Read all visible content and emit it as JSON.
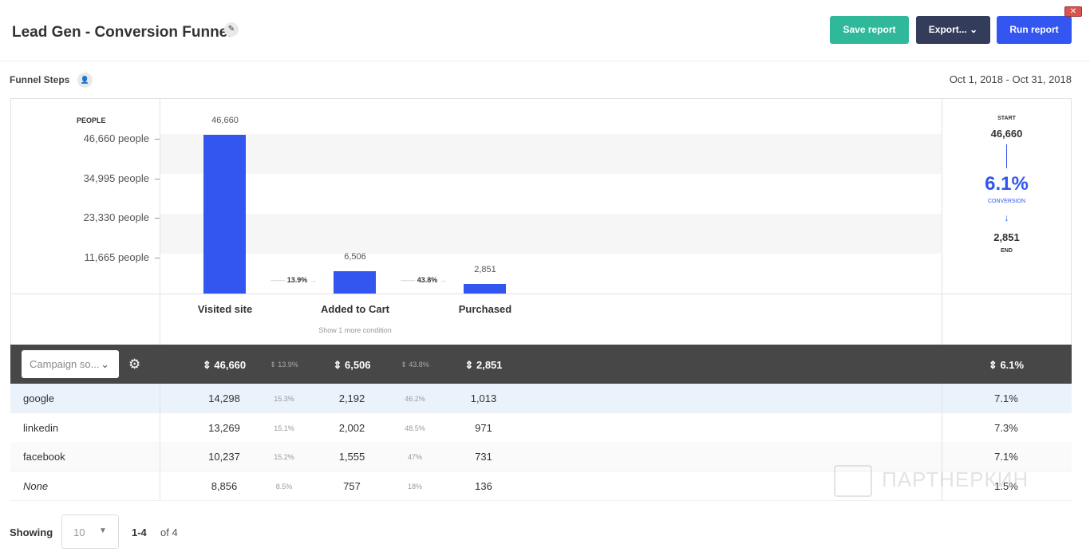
{
  "header": {
    "title": "Lead Gen - Conversion Funnel",
    "save": "Save report",
    "export": "Export...",
    "run": "Run report"
  },
  "funnel": {
    "label": "Funnel Steps",
    "date_range": "Oct 1, 2018 - Oct 31, 2018"
  },
  "chart_data": {
    "type": "bar",
    "ylabel": "PEOPLE",
    "yticks": [
      "46,660 people",
      "34,995 people",
      "23,330 people",
      "11,665 people"
    ],
    "ylim": [
      0,
      46660
    ],
    "categories": [
      "Visited site",
      "Added to Cart",
      "Purchased"
    ],
    "values": [
      46660,
      6506,
      2851
    ],
    "value_labels": [
      "46,660",
      "6,506",
      "2,851"
    ],
    "step_conversions": [
      "13.9%",
      "43.8%"
    ],
    "condition_note": "Show 1 more condition"
  },
  "summary": {
    "start_label": "START",
    "start": "46,660",
    "conversion": "6.1%",
    "conversion_label": "CONVERSION",
    "end": "2,851",
    "end_label": "END"
  },
  "table": {
    "group_by": "Campaign so...",
    "totals": [
      "46,660",
      "13.9%",
      "6,506",
      "43.8%",
      "2,851",
      "6.1%"
    ],
    "rows": [
      {
        "name": "google",
        "v": [
          "14,298",
          "15.3%",
          "2,192",
          "46.2%",
          "1,013",
          "7.1%"
        ]
      },
      {
        "name": "linkedin",
        "v": [
          "13,269",
          "15.1%",
          "2,002",
          "48.5%",
          "971",
          "7.3%"
        ]
      },
      {
        "name": "facebook",
        "v": [
          "10,237",
          "15.2%",
          "1,555",
          "47%",
          "731",
          "7.1%"
        ]
      },
      {
        "name": "None",
        "v": [
          "8,856",
          "8.5%",
          "757",
          "18%",
          "136",
          "1.5%"
        ]
      }
    ]
  },
  "pagination": {
    "showing": "Showing",
    "per_page": "10",
    "range": "1-4",
    "of": "of 4"
  },
  "watermark": "ПАРТНЕРКИН",
  "colors": {
    "bar": "#3355f0",
    "save": "#2fb99a",
    "export": "#343c5c",
    "run": "#3355f0"
  }
}
